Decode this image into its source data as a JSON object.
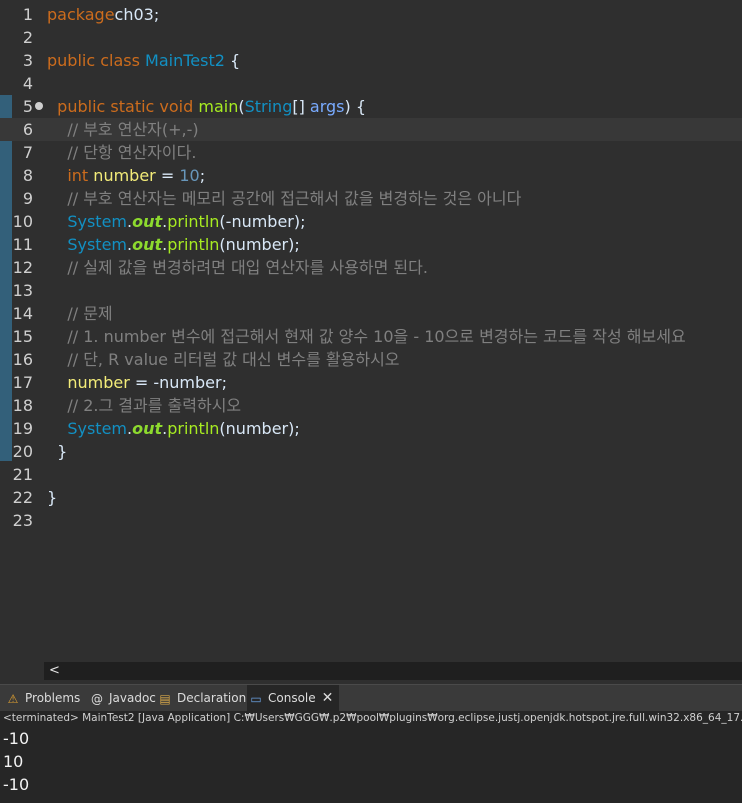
{
  "editor": {
    "lines": [
      {
        "n": "1",
        "tokens": [
          [
            "kw",
            "package"
          ],
          [
            "",
            "ch03;"
          ]
        ]
      },
      {
        "n": "2",
        "tokens": []
      },
      {
        "n": "3",
        "tokens": [
          [
            "kw",
            "public class "
          ],
          [
            "cls",
            "MainTest2"
          ],
          [
            "",
            " {"
          ]
        ]
      },
      {
        "n": "4",
        "tokens": []
      },
      {
        "n": "5",
        "fold": true,
        "tokens": [
          [
            "",
            "  "
          ],
          [
            "kw",
            "public static void "
          ],
          [
            "meth",
            "main"
          ],
          [
            "",
            "("
          ],
          [
            "cls",
            "String"
          ],
          [
            "",
            "[] "
          ],
          [
            "param",
            "args"
          ],
          [
            "",
            ") {"
          ]
        ]
      },
      {
        "n": "6",
        "current": true,
        "tokens": [
          [
            "",
            "    "
          ],
          [
            "cmt",
            "// 부호 연산자(+,-)"
          ]
        ]
      },
      {
        "n": "7",
        "tokens": [
          [
            "",
            "    "
          ],
          [
            "cmt",
            "// 단항 연산자이다."
          ]
        ]
      },
      {
        "n": "8",
        "tokens": [
          [
            "",
            "    "
          ],
          [
            "kw",
            "int "
          ],
          [
            "var",
            "number"
          ],
          [
            "",
            " = "
          ],
          [
            "num",
            "10"
          ],
          [
            "",
            ";"
          ]
        ]
      },
      {
        "n": "9",
        "tokens": [
          [
            "",
            "    "
          ],
          [
            "cmt",
            "// 부호 연산자는 메모리 공간에 접근해서 값을 변경하는 것은 아니다"
          ]
        ]
      },
      {
        "n": "10",
        "tokens": [
          [
            "",
            "    "
          ],
          [
            "cls",
            "System"
          ],
          [
            "",
            "."
          ],
          [
            "field",
            "out"
          ],
          [
            "",
            "."
          ],
          [
            "meth",
            "println"
          ],
          [
            "",
            "(-number);"
          ]
        ]
      },
      {
        "n": "11",
        "tokens": [
          [
            "",
            "    "
          ],
          [
            "cls",
            "System"
          ],
          [
            "",
            "."
          ],
          [
            "field",
            "out"
          ],
          [
            "",
            "."
          ],
          [
            "meth",
            "println"
          ],
          [
            "",
            "(number);"
          ]
        ]
      },
      {
        "n": "12",
        "tokens": [
          [
            "",
            "    "
          ],
          [
            "cmt",
            "// 실제 값을 변경하려면 대입 연산자를 사용하면 된다."
          ]
        ]
      },
      {
        "n": "13",
        "tokens": []
      },
      {
        "n": "14",
        "tokens": [
          [
            "",
            "    "
          ],
          [
            "cmt",
            "// 문제"
          ]
        ]
      },
      {
        "n": "15",
        "tokens": [
          [
            "",
            "    "
          ],
          [
            "cmt",
            "// 1. number 변수에 접근해서 현재 값 양수 10을 - 10으로 변경하는 코드를 작성 해보세요"
          ]
        ]
      },
      {
        "n": "16",
        "tokens": [
          [
            "",
            "    "
          ],
          [
            "cmt",
            "// 단, R value 리터럴 값 대신 변수를 활용하시오"
          ]
        ]
      },
      {
        "n": "17",
        "tokens": [
          [
            "",
            "    "
          ],
          [
            "var",
            "number"
          ],
          [
            "",
            " = -number;"
          ]
        ]
      },
      {
        "n": "18",
        "tokens": [
          [
            "",
            "    "
          ],
          [
            "cmt",
            "// 2.그 결과를 출력하시오"
          ]
        ]
      },
      {
        "n": "19",
        "tokens": [
          [
            "",
            "    "
          ],
          [
            "cls",
            "System"
          ],
          [
            "",
            "."
          ],
          [
            "field",
            "out"
          ],
          [
            "",
            "."
          ],
          [
            "meth",
            "println"
          ],
          [
            "",
            "(number);"
          ]
        ]
      },
      {
        "n": "20",
        "tokens": [
          [
            "",
            "  }"
          ]
        ]
      },
      {
        "n": "21",
        "tokens": []
      },
      {
        "n": "22",
        "tokens": [
          [
            "",
            "}"
          ]
        ]
      },
      {
        "n": "23",
        "tokens": []
      }
    ]
  },
  "scrollbar": {
    "left_arrow": "<"
  },
  "tabs": [
    {
      "id": "problems",
      "label": "Problems",
      "icon": "problems-icon",
      "glyph": "⚠",
      "color": "#e0a030"
    },
    {
      "id": "javadoc",
      "label": "Javadoc",
      "icon": "javadoc-icon",
      "glyph": "@",
      "color": "#dcdcdc"
    },
    {
      "id": "declaration",
      "label": "Declaration",
      "icon": "declaration-icon",
      "glyph": "▤",
      "color": "#d8a84a"
    },
    {
      "id": "console",
      "label": "Console",
      "icon": "console-icon",
      "glyph": "▭",
      "color": "#6aa0e0",
      "active": true
    }
  ],
  "console": {
    "status": "<terminated> MainTest2 [Java Application] C:₩Users₩GGG₩.p2₩pool₩plugins₩org.eclipse.justj.openjdk.hotspot.jre.full.win32.x86_64_17.",
    "output": [
      "-10",
      "10",
      "-10"
    ]
  },
  "colors": {
    "editor_bg": "#2f2f2f",
    "keyword": "#cc6c1d",
    "class": "#1290c3",
    "method": "#a7ec21",
    "variable": "#f3ec79",
    "comment": "#808080"
  }
}
